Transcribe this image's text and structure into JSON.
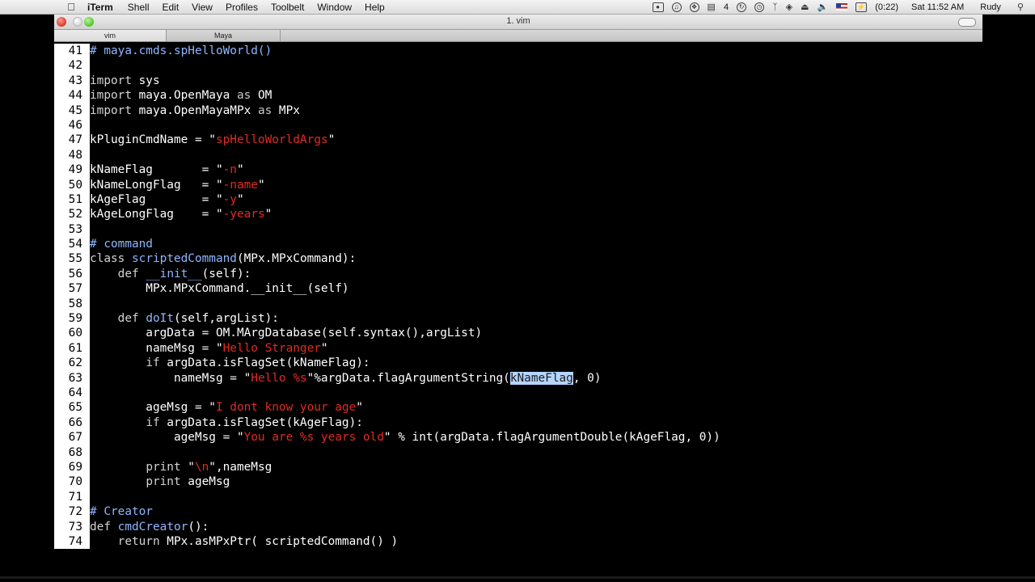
{
  "menubar": {
    "apple": "",
    "app_name": "iTerm",
    "menus": [
      "Shell",
      "Edit",
      "View",
      "Profiles",
      "Toolbelt",
      "Window",
      "Help"
    ],
    "status": {
      "space_number": "4",
      "battery": "(0:22)",
      "clock": "Sat 11:52 AM",
      "user": "Rudy"
    }
  },
  "window": {
    "title": "1. vim",
    "tabs": [
      "vim",
      "Maya"
    ]
  },
  "editor": {
    "lines": [
      {
        "n": "41",
        "tokens": [
          {
            "t": "# maya.cmds.spHelloWorld()",
            "c": "comment"
          }
        ]
      },
      {
        "n": "42",
        "tokens": []
      },
      {
        "n": "43",
        "tokens": [
          {
            "t": "import",
            "c": "keyword"
          },
          {
            "t": " sys",
            "c": "normal"
          }
        ]
      },
      {
        "n": "44",
        "tokens": [
          {
            "t": "import",
            "c": "keyword"
          },
          {
            "t": " maya.OpenMaya ",
            "c": "normal"
          },
          {
            "t": "as",
            "c": "op"
          },
          {
            "t": " OM",
            "c": "normal"
          }
        ]
      },
      {
        "n": "45",
        "tokens": [
          {
            "t": "import",
            "c": "keyword"
          },
          {
            "t": " maya.OpenMayaMPx ",
            "c": "normal"
          },
          {
            "t": "as",
            "c": "op"
          },
          {
            "t": " MPx",
            "c": "normal"
          }
        ]
      },
      {
        "n": "46",
        "tokens": []
      },
      {
        "n": "47",
        "tokens": [
          {
            "t": "kPluginCmdName = \"",
            "c": "normal"
          },
          {
            "t": "spHelloWorldArgs",
            "c": "string"
          },
          {
            "t": "\"",
            "c": "normal"
          }
        ]
      },
      {
        "n": "48",
        "tokens": []
      },
      {
        "n": "49",
        "tokens": [
          {
            "t": "kNameFlag       = \"",
            "c": "normal"
          },
          {
            "t": "-n",
            "c": "string"
          },
          {
            "t": "\"",
            "c": "normal"
          }
        ]
      },
      {
        "n": "50",
        "tokens": [
          {
            "t": "kNameLongFlag   = \"",
            "c": "normal"
          },
          {
            "t": "-name",
            "c": "string"
          },
          {
            "t": "\"",
            "c": "normal"
          }
        ]
      },
      {
        "n": "51",
        "tokens": [
          {
            "t": "kAgeFlag        = \"",
            "c": "normal"
          },
          {
            "t": "-y",
            "c": "string"
          },
          {
            "t": "\"",
            "c": "normal"
          }
        ]
      },
      {
        "n": "52",
        "tokens": [
          {
            "t": "kAgeLongFlag    = \"",
            "c": "normal"
          },
          {
            "t": "-years",
            "c": "string"
          },
          {
            "t": "\"",
            "c": "normal"
          }
        ]
      },
      {
        "n": "53",
        "tokens": []
      },
      {
        "n": "54",
        "tokens": [
          {
            "t": "# command",
            "c": "comment"
          }
        ]
      },
      {
        "n": "55",
        "tokens": [
          {
            "t": "class",
            "c": "keyword"
          },
          {
            "t": " ",
            "c": "normal"
          },
          {
            "t": "scriptedCommand",
            "c": "func"
          },
          {
            "t": "(MPx.MPxCommand):",
            "c": "normal"
          }
        ]
      },
      {
        "n": "56",
        "tokens": [
          {
            "t": "    ",
            "c": "normal"
          },
          {
            "t": "def",
            "c": "keyword"
          },
          {
            "t": " ",
            "c": "normal"
          },
          {
            "t": "__init__",
            "c": "func"
          },
          {
            "t": "(self):",
            "c": "normal"
          }
        ]
      },
      {
        "n": "57",
        "tokens": [
          {
            "t": "        MPx.MPxCommand.__init__(self)",
            "c": "normal"
          }
        ]
      },
      {
        "n": "58",
        "tokens": []
      },
      {
        "n": "59",
        "tokens": [
          {
            "t": "    ",
            "c": "normal"
          },
          {
            "t": "def",
            "c": "keyword"
          },
          {
            "t": " ",
            "c": "normal"
          },
          {
            "t": "doIt",
            "c": "func"
          },
          {
            "t": "(self,argList):",
            "c": "normal"
          }
        ]
      },
      {
        "n": "60",
        "tokens": [
          {
            "t": "        argData = OM.MArgDatabase(self.syntax(),argList)",
            "c": "normal"
          }
        ]
      },
      {
        "n": "61",
        "tokens": [
          {
            "t": "        nameMsg = \"",
            "c": "normal"
          },
          {
            "t": "Hello Stranger",
            "c": "string"
          },
          {
            "t": "\"",
            "c": "normal"
          }
        ]
      },
      {
        "n": "62",
        "tokens": [
          {
            "t": "        ",
            "c": "normal"
          },
          {
            "t": "if",
            "c": "keyword"
          },
          {
            "t": " argData.isFlagSet(kNameFlag):",
            "c": "normal"
          }
        ]
      },
      {
        "n": "63",
        "tokens": [
          {
            "t": "            nameMsg = \"",
            "c": "normal"
          },
          {
            "t": "Hello %s",
            "c": "string"
          },
          {
            "t": "\"%argData.flagArgumentString(",
            "c": "normal"
          },
          {
            "t": "kNameFlag",
            "c": "select"
          },
          {
            "t": ", 0)",
            "c": "normal"
          }
        ]
      },
      {
        "n": "64",
        "tokens": []
      },
      {
        "n": "65",
        "tokens": [
          {
            "t": "        ageMsg = \"",
            "c": "normal"
          },
          {
            "t": "I dont know your age",
            "c": "string"
          },
          {
            "t": "\"",
            "c": "normal"
          }
        ]
      },
      {
        "n": "66",
        "tokens": [
          {
            "t": "        ",
            "c": "normal"
          },
          {
            "t": "if",
            "c": "keyword"
          },
          {
            "t": " argData.isFlagSet(kAgeFlag):",
            "c": "normal"
          }
        ]
      },
      {
        "n": "67",
        "tokens": [
          {
            "t": "            ageMsg = \"",
            "c": "normal"
          },
          {
            "t": "You are %s years old",
            "c": "string"
          },
          {
            "t": "\" % int(argData.flagArgumentDouble(kAgeFlag, 0))",
            "c": "normal"
          }
        ]
      },
      {
        "n": "68",
        "tokens": []
      },
      {
        "n": "69",
        "tokens": [
          {
            "t": "        ",
            "c": "normal"
          },
          {
            "t": "print",
            "c": "keyword"
          },
          {
            "t": " \"",
            "c": "normal"
          },
          {
            "t": "\\n",
            "c": "string"
          },
          {
            "t": "\",nameMsg",
            "c": "normal"
          }
        ]
      },
      {
        "n": "70",
        "tokens": [
          {
            "t": "        ",
            "c": "normal"
          },
          {
            "t": "print",
            "c": "keyword"
          },
          {
            "t": " ageMsg",
            "c": "normal"
          }
        ]
      },
      {
        "n": "71",
        "tokens": []
      },
      {
        "n": "72",
        "tokens": [
          {
            "t": "# Creator",
            "c": "comment"
          }
        ]
      },
      {
        "n": "73",
        "tokens": [
          {
            "t": "def",
            "c": "keyword"
          },
          {
            "t": " ",
            "c": "normal"
          },
          {
            "t": "cmdCreator",
            "c": "func"
          },
          {
            "t": "():",
            "c": "normal"
          }
        ]
      },
      {
        "n": "74",
        "tokens": [
          {
            "t": "    ",
            "c": "normal"
          },
          {
            "t": "return",
            "c": "keyword"
          },
          {
            "t": " MPx.asMPxPtr( scriptedCommand() )",
            "c": "normal"
          }
        ]
      }
    ]
  }
}
